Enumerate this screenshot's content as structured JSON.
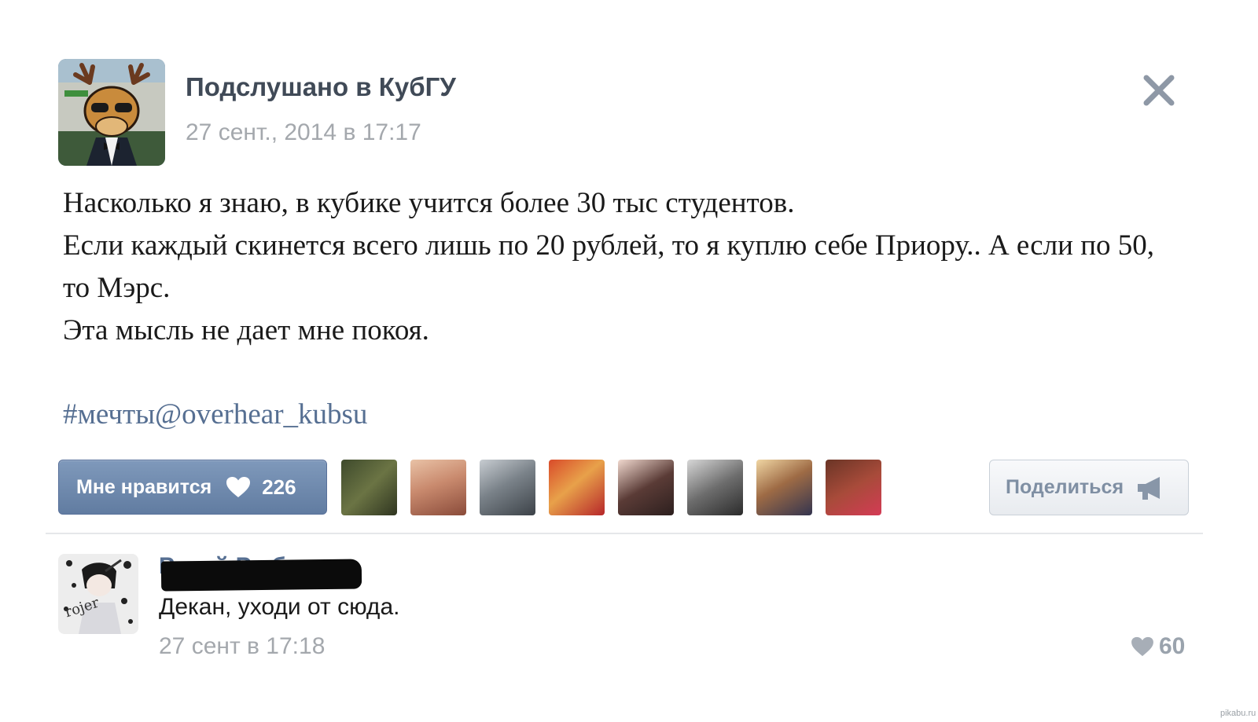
{
  "post": {
    "group_name": "Подслушано в КубГУ",
    "date": "27 сент., 2014 в 17:17",
    "text_lines": [
      "Насколько я знаю, в кубике учится более 30 тыс студентов.",
      "Если каждый скинется всего лишь по 20 рублей, то я куплю себе Приору.. А если по 50, то Мэрс.",
      "Эта мысль не дает мне покоя."
    ],
    "hashtag": "#мечты@overhear_kubsu",
    "avatar_icon": "moose-avatar-icon",
    "close_icon": "close-icon"
  },
  "actions": {
    "like_label": "Мне нравится",
    "like_count": "226",
    "share_label": "Поделиться",
    "like_icon": "heart-icon",
    "share_icon": "megaphone-icon",
    "liker_count": 8
  },
  "comment": {
    "author": "Ручей Рыбков",
    "text": "Декан, уходи от сюда.",
    "date": "27 сент в 17:18",
    "like_count": "60",
    "avatar_text": "rojer"
  },
  "watermark": "pikabu.ru",
  "colors": {
    "like_button": "#6f89ae",
    "link": "#566f92",
    "muted": "#a4a8ad",
    "share_text": "#7f8fa3"
  }
}
